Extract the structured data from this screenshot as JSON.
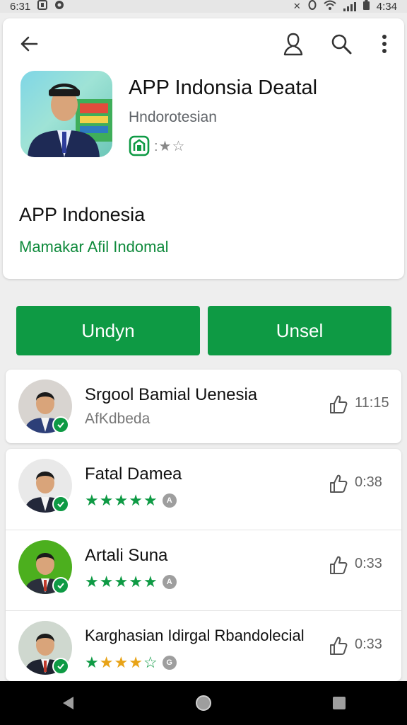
{
  "status_bar": {
    "time_left": "6:31",
    "time_right": "4:34",
    "icons_left": [
      "notification-icon",
      "app-notification-icon"
    ],
    "icons_right": [
      "mute-icon",
      "alarm-icon",
      "wifi-icon",
      "signal-icon",
      "battery-icon"
    ]
  },
  "header": {
    "back_icon": "arrow-left-icon",
    "account_icon": "account-icon",
    "search_icon": "search-icon",
    "menu_icon": "more-vert-icon"
  },
  "app": {
    "title": "APP Indonsia Deatal",
    "developer": "Hndorotesian",
    "rating_text": ":★☆",
    "section_title": "APP Indonesia",
    "section_subtitle": "Mamakar Afil Indomal"
  },
  "buttons": {
    "primary_label": "Undyn",
    "secondary_label": "Unsel"
  },
  "list": {
    "featured": {
      "title": "Srgool Bamial Uenesia",
      "subtitle": "AfKdbeda",
      "time": "11:15"
    },
    "items": [
      {
        "title": "Fatal Damea",
        "rating": 5,
        "time": "0:38",
        "avatar_bg": "#e9e9e9"
      },
      {
        "title": "Artali Suna",
        "rating": 5,
        "time": "0:33",
        "avatar_bg": "#4caf1e"
      },
      {
        "title": "Karghasian Idirgal Rbandolecial",
        "rating": 4,
        "time": "0:33",
        "avatar_bg": "#cfd8cf"
      }
    ]
  },
  "colors": {
    "accent_green": "#0e9a44",
    "star_gold": "#e8a317",
    "nav_bar": "#000000"
  },
  "nav": {
    "back_icon": "nav-back-icon",
    "home_icon": "nav-home-icon",
    "recents_icon": "nav-recents-icon"
  }
}
